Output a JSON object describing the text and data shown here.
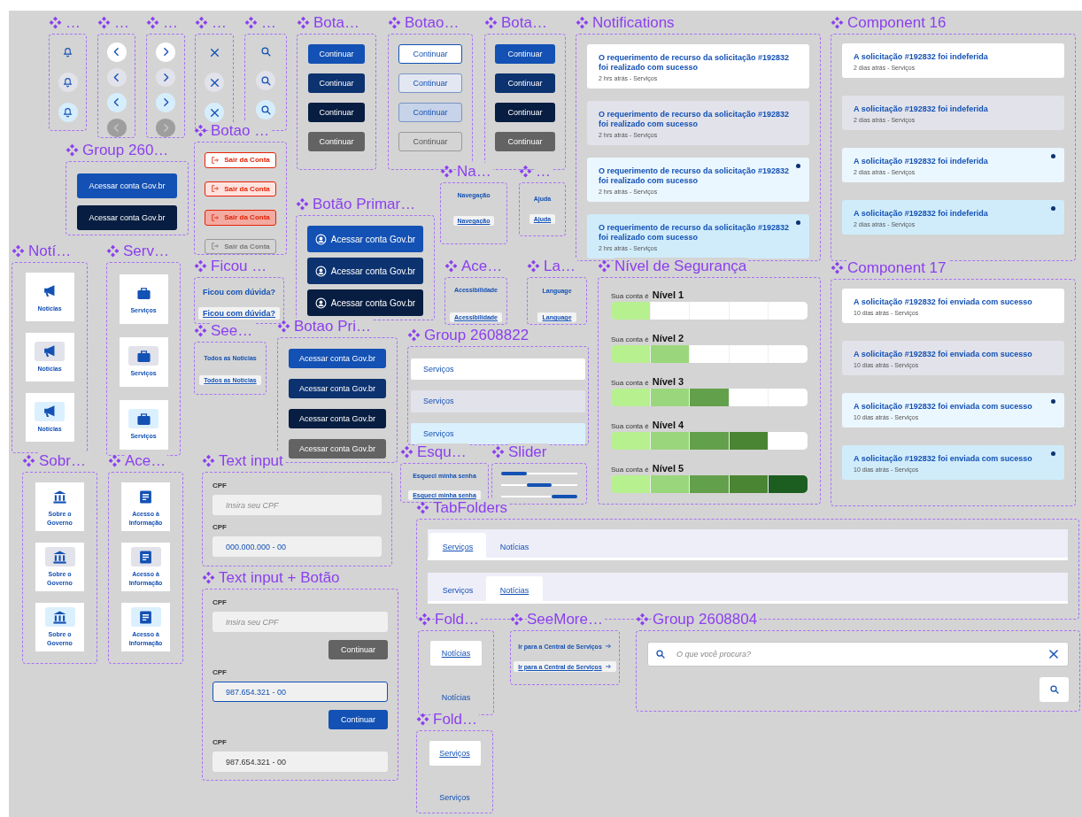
{
  "frames": [
    {
      "title": "…",
      "kind": "bell_buttons",
      "items": [
        {
          "kind": "default"
        },
        {
          "kind": "hover"
        },
        {
          "kind": "pressed"
        }
      ]
    },
    {
      "title": "…",
      "kind": "prev_buttons",
      "items": [
        {
          "kind": "default"
        },
        {
          "kind": "hover"
        },
        {
          "kind": "pressed"
        },
        {
          "kind": "disabled"
        }
      ]
    },
    {
      "title": "…",
      "kind": "next_buttons",
      "items": [
        {
          "kind": "default"
        },
        {
          "kind": "hover"
        },
        {
          "kind": "pressed"
        },
        {
          "kind": "disabled"
        }
      ]
    },
    {
      "title": "…",
      "kind": "close_buttons",
      "items": [
        {
          "kind": "default"
        },
        {
          "kind": "hover"
        },
        {
          "kind": "pressed"
        }
      ]
    },
    {
      "title": "…",
      "kind": "search_buttons",
      "items": [
        {
          "kind": "default"
        },
        {
          "kind": "hover"
        },
        {
          "kind": "pressed"
        }
      ]
    },
    {
      "title": "Bota…",
      "kind": "solid_buttons",
      "items": [
        {
          "label": "Continuar",
          "kind": "default"
        },
        {
          "label": "Continuar",
          "kind": "hover"
        },
        {
          "label": "Continuar",
          "kind": "pressed"
        },
        {
          "label": "Continuar",
          "kind": "disabled"
        }
      ]
    },
    {
      "title": "Botao…",
      "kind": "outline_buttons",
      "items": [
        {
          "label": "Continuar",
          "kind": "default"
        },
        {
          "label": "Continuar",
          "kind": "hover"
        },
        {
          "label": "Continuar",
          "kind": "pressed"
        },
        {
          "label": "Continuar",
          "kind": "disabled"
        }
      ]
    },
    {
      "title": "Bota…",
      "kind": "solid_buttons",
      "items": [
        {
          "label": "Continuar",
          "kind": "default"
        },
        {
          "label": "Continuar",
          "kind": "hover"
        },
        {
          "label": "Continuar",
          "kind": "pressed"
        },
        {
          "label": "Continuar",
          "kind": "disabled"
        }
      ]
    },
    {
      "title": "Notifications",
      "kind": "notifications",
      "items": [
        {
          "title": "O requerimento de recurso da solicitação #192832 foi realizado com sucesso",
          "meta": "2 hrs atrás - Serviços",
          "kind": "default",
          "unread": false
        },
        {
          "title": "O requerimento de recurso da solicitação #192832 foi realizado com sucesso",
          "meta": "2 hrs atrás - Serviços",
          "kind": "hover",
          "unread": false
        },
        {
          "title": "O requerimento de recurso da solicitação #192832 foi realizado com sucesso",
          "meta": "2 hrs atrás - Serviços",
          "kind": "default",
          "unread": true
        },
        {
          "title": "O requerimento de recurso da solicitação #192832 foi realizado com sucesso",
          "meta": "2 hrs atrás - Serviços",
          "kind": "pressed",
          "unread": true
        }
      ]
    },
    {
      "title": "Component 16",
      "kind": "notifications",
      "items": [
        {
          "title": "A solicitação #192832 foi indeferida",
          "meta": "2 dias atrás - Serviços",
          "kind": "default",
          "unread": false
        },
        {
          "title": "A solicitação #192832 foi indeferida",
          "meta": "2 dias atrás - Serviços",
          "kind": "hover",
          "unread": false
        },
        {
          "title": "A solicitação #192832 foi indeferida",
          "meta": "2 dias atrás - Serviços",
          "kind": "default",
          "unread": true
        },
        {
          "title": "A solicitação #192832 foi indeferida",
          "meta": "2 dias atrás - Serviços",
          "kind": "pressed",
          "unread": true
        }
      ]
    },
    {
      "title": "Group 260…",
      "kind": "solid_buttons",
      "items": [
        {
          "label": "Acessar conta Gov.br",
          "kind": "default"
        },
        {
          "label": "Acessar conta Gov.br",
          "kind": "pressed"
        }
      ]
    },
    {
      "title": "Botao …",
      "kind": "logout_buttons",
      "items": [
        {
          "label": "Sair da Conta",
          "kind": "default"
        },
        {
          "label": "Sair da Conta",
          "kind": "hover"
        },
        {
          "label": "Sair da Conta",
          "kind": "pressed"
        },
        {
          "label": "Sair da Conta",
          "kind": "disabled"
        }
      ]
    },
    {
      "title": "Botão Primar…",
      "kind": "account_buttons",
      "items": [
        {
          "label": "Acessar conta Gov.br",
          "kind": "default"
        },
        {
          "label": "Acessar conta Gov.br",
          "kind": "hover"
        },
        {
          "label": "Acessar conta Gov.br",
          "kind": "pressed"
        }
      ]
    },
    {
      "title": "Na…",
      "kind": "text_links",
      "items": [
        {
          "label": "Navegação",
          "kind": "default"
        },
        {
          "label": "Navegação",
          "kind": "focus"
        }
      ]
    },
    {
      "title": "…",
      "kind": "text_links",
      "items": [
        {
          "label": "Ajuda",
          "kind": "default"
        },
        {
          "label": "Ajuda",
          "kind": "focus"
        }
      ]
    },
    {
      "title": "Notí…",
      "kind": "news_tiles",
      "items": [
        {
          "label": "Notícias",
          "kind": "default"
        },
        {
          "label": "Notícias",
          "kind": "hover"
        },
        {
          "label": "Notícias",
          "kind": "pressed"
        }
      ]
    },
    {
      "title": "Serv…",
      "kind": "service_tiles",
      "items": [
        {
          "label": "Serviços",
          "kind": "default"
        },
        {
          "label": "Serviços",
          "kind": "hover"
        },
        {
          "label": "Serviços",
          "kind": "pressed"
        }
      ]
    },
    {
      "title": "Ficou …",
      "kind": "text_links",
      "items": [
        {
          "label": "Ficou com dúvida?",
          "kind": "default"
        },
        {
          "label": "Ficou com dúvida?",
          "kind": "focus"
        }
      ]
    },
    {
      "title": "See…",
      "kind": "text_links",
      "items": [
        {
          "label": "Todos as Notícias",
          "kind": "default"
        },
        {
          "label": "Todos as Notícias",
          "kind": "focus"
        }
      ]
    },
    {
      "title": "Botao Pri…",
      "kind": "solid_buttons",
      "items": [
        {
          "label": "Acessar conta Gov.br",
          "kind": "default"
        },
        {
          "label": "Acessar conta Gov.br",
          "kind": "hover"
        },
        {
          "label": "Acessar conta Gov.br",
          "kind": "pressed"
        },
        {
          "label": "Acessar conta Gov.br",
          "kind": "disabled"
        }
      ]
    },
    {
      "title": "Ace…",
      "kind": "text_links",
      "items": [
        {
          "label": "Acessibilidade",
          "kind": "default"
        },
        {
          "label": "Acessibilidade",
          "kind": "focus"
        }
      ]
    },
    {
      "title": "La…",
      "kind": "text_links",
      "items": [
        {
          "label": "Language",
          "kind": "default"
        },
        {
          "label": "Language",
          "kind": "focus"
        }
      ]
    },
    {
      "title": "Group 2608822",
      "kind": "menu_rows",
      "items": [
        {
          "label": "Serviços",
          "kind": "default"
        },
        {
          "label": "Serviços",
          "kind": "hover"
        },
        {
          "label": "Serviços",
          "kind": "pressed"
        }
      ]
    },
    {
      "title": "Nível de Segurança",
      "kind": "security_levels",
      "items": [
        {
          "prefix": "Sua conta é",
          "label": "Nível 1",
          "segments": [
            {
              "filled": true
            },
            {
              "filled": false
            },
            {
              "filled": false
            },
            {
              "filled": false
            },
            {
              "filled": false
            }
          ]
        },
        {
          "prefix": "Sua conta é",
          "label": "Nível 2",
          "segments": [
            {
              "filled": true
            },
            {
              "filled": true
            },
            {
              "filled": false
            },
            {
              "filled": false
            },
            {
              "filled": false
            }
          ]
        },
        {
          "prefix": "Sua conta é",
          "label": "Nível 3",
          "segments": [
            {
              "filled": true
            },
            {
              "filled": true
            },
            {
              "filled": true
            },
            {
              "filled": false
            },
            {
              "filled": false
            }
          ]
        },
        {
          "prefix": "Sua conta é",
          "label": "Nível 4",
          "segments": [
            {
              "filled": true
            },
            {
              "filled": true
            },
            {
              "filled": true
            },
            {
              "filled": true
            },
            {
              "filled": false
            }
          ]
        },
        {
          "prefix": "Sua conta é",
          "label": "Nível 5",
          "segments": [
            {
              "filled": true
            },
            {
              "filled": true
            },
            {
              "filled": true
            },
            {
              "filled": true
            },
            {
              "filled": true
            }
          ]
        }
      ]
    },
    {
      "title": "Component 17",
      "kind": "notifications",
      "items": [
        {
          "title": "A solicitação #192832 foi enviada com sucesso",
          "meta": "10 dias atrás - Serviços",
          "kind": "default",
          "unread": false
        },
        {
          "title": "A solicitação #192832 foi enviada com sucesso",
          "meta": "10 dias atrás - Serviços",
          "kind": "hover",
          "unread": false
        },
        {
          "title": "A solicitação #192832 foi enviada com sucesso",
          "meta": "10 dias atrás - Serviços",
          "kind": "default",
          "unread": true
        },
        {
          "title": "A solicitação #192832 foi enviada com sucesso",
          "meta": "10 dias atrás - Serviços",
          "kind": "pressed",
          "unread": true
        }
      ]
    },
    {
      "title": "Sobr…",
      "kind": "government_tiles",
      "items": [
        {
          "label": "Sobre o Governo",
          "kind": "default"
        },
        {
          "label": "Sobre o Governo",
          "kind": "hover"
        },
        {
          "label": "Sobre o Governo",
          "kind": "pressed"
        }
      ]
    },
    {
      "title": "Ace…",
      "kind": "document_tiles",
      "items": [
        {
          "label": "Acesso à Informação",
          "kind": "default"
        },
        {
          "label": "Acesso à Informação",
          "kind": "hover"
        },
        {
          "label": "Acesso à Informação",
          "kind": "pressed"
        }
      ]
    },
    {
      "title": "Text input",
      "kind": "form",
      "items": [
        {
          "kind": "field",
          "label": "CPF",
          "placeholder": "Insira seu CPF",
          "focused": false
        },
        {
          "kind": "field",
          "label": "CPF",
          "value": "000.000.000 - 00",
          "focused": false,
          "active": true
        }
      ]
    },
    {
      "title": "Esqu…",
      "kind": "text_links",
      "items": [
        {
          "label": "Esqueci  minha senha",
          "kind": "default"
        },
        {
          "label": "Esqueci  minha senha",
          "kind": "focus"
        }
      ]
    },
    {
      "title": "Slider",
      "kind": "indicators",
      "items": [
        {
          "segments": [
            {
              "selected": true
            },
            {
              "selected": false
            },
            {
              "selected": false
            }
          ]
        },
        {
          "segments": [
            {
              "selected": false
            },
            {
              "selected": true
            },
            {
              "selected": false
            }
          ]
        },
        {
          "segments": [
            {
              "selected": false
            },
            {
              "selected": false
            },
            {
              "selected": true
            }
          ]
        }
      ]
    },
    {
      "title": "TabFolders",
      "kind": "tab_bars",
      "items": [
        {
          "tabs": [
            {
              "label": "Serviços",
              "selected": true
            },
            {
              "label": "Notícias",
              "selected": false
            }
          ]
        },
        {
          "tabs": [
            {
              "label": "Serviços",
              "selected": false
            },
            {
              "label": "Notícias",
              "selected": true
            }
          ]
        }
      ]
    },
    {
      "title": "Fold…",
      "kind": "folders",
      "items": [
        {
          "label": "Notícias",
          "selected": true
        },
        {
          "label": "Notícias",
          "selected": false
        }
      ]
    },
    {
      "title": "Fold…",
      "kind": "folders",
      "items": [
        {
          "label": "Serviços",
          "selected": true
        },
        {
          "label": "Serviços",
          "selected": false
        }
      ]
    },
    {
      "title": "SeeMore…",
      "kind": "arrow_links",
      "items": [
        {
          "label": "Ir para a Central de Serviços",
          "kind": "default"
        },
        {
          "label": "Ir para a Central de Serviços",
          "kind": "focus"
        }
      ]
    },
    {
      "title": "Group 2608804",
      "kind": "search",
      "placeholder": "O que você procura?"
    },
    {
      "title": "Text input + Botão",
      "kind": "form",
      "items": [
        {
          "kind": "field",
          "label": "CPF",
          "placeholder": "Insira seu CPF",
          "focused": false
        },
        {
          "kind": "button",
          "label": "Continuar",
          "disabled": true
        },
        {
          "kind": "field",
          "label": "CPF",
          "value": "987.654.321 - 00",
          "focused": true
        },
        {
          "kind": "button",
          "label": "Continuar",
          "disabled": false
        },
        {
          "kind": "field",
          "label": "CPF",
          "value": "987.654.321 - 00",
          "focused": false,
          "active": false
        }
      ]
    }
  ]
}
